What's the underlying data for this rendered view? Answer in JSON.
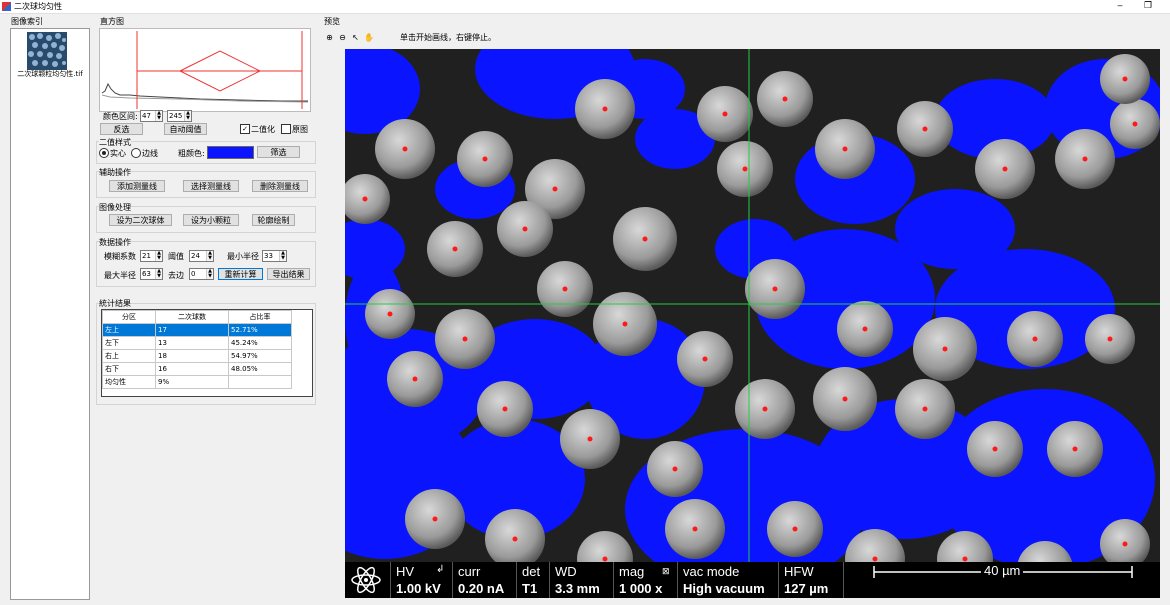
{
  "window": {
    "title": "二次球均匀性",
    "minimize": "‒",
    "maximize": "❐"
  },
  "left_panel": {
    "label": "图像索引",
    "thumb_caption": "二次球颗粒均匀性.tif"
  },
  "histogram": {
    "label": "直方图",
    "range_label": "颜色区间:",
    "range_low": "47",
    "range_high": "245",
    "invert_button": "反选",
    "auto_threshold_button": "自动阈值",
    "binarize_label": "二值化",
    "binarize_checked": true,
    "original_label": "原图",
    "original_checked": false
  },
  "binary_style": {
    "label": "二值样式",
    "solid_label": "实心",
    "edge_label": "边线",
    "color_label": "粗颜色:",
    "color": "#0a14ff",
    "filter_button": "筛选"
  },
  "aux_ops": {
    "label": "辅助操作",
    "add_line": "添加测量线",
    "select_line": "选择测量线",
    "delete_line": "删除测量线"
  },
  "image_proc": {
    "label": "图像处理",
    "set_secondary": "设为二次球体",
    "set_small": "设为小颗粒",
    "outline": "轮廓绘制"
  },
  "data_ops": {
    "label": "数据操作",
    "erode_label": "模糊系数",
    "erode_value": "21",
    "threshold_label": "阈值",
    "threshold_value": "24",
    "min_radius_label": "最小半径",
    "min_radius_value": "33",
    "max_radius_label": "最大半径",
    "max_radius_value": "63",
    "remove_edge_label": "去边",
    "remove_edge_value": "0",
    "recalc_button": "重新计算",
    "export_button": "导出结果"
  },
  "results": {
    "label": "統计结果",
    "headers": [
      "分区",
      "二次球数",
      "占比率"
    ],
    "rows": [
      [
        "左上",
        "17",
        "52.71%"
      ],
      [
        "左下",
        "13",
        "45.24%"
      ],
      [
        "右上",
        "18",
        "54.97%"
      ],
      [
        "右下",
        "16",
        "48.05%"
      ],
      [
        "均匀性",
        "9%",
        ""
      ]
    ]
  },
  "preview": {
    "label": "预览",
    "hint": "单击开始画线，右键停止。",
    "icons": [
      "zoom-in-icon",
      "zoom-out-icon",
      "pointer-icon",
      "hand-icon"
    ]
  },
  "sem_info": {
    "hv_label": "HV",
    "hv_value": "1.00 kV",
    "curr_label": "curr",
    "curr_value": "0.20 nA",
    "det_label": "det",
    "det_value": "T1",
    "wd_label": "WD",
    "wd_value": "3.3 mm",
    "mag_label": "mag",
    "mag_value": "1 000 x",
    "vac_label": "vac mode",
    "vac_value": "High vacuum",
    "hfw_label": "HFW",
    "hfw_value": "127 µm",
    "scale_label": "40 µm"
  }
}
